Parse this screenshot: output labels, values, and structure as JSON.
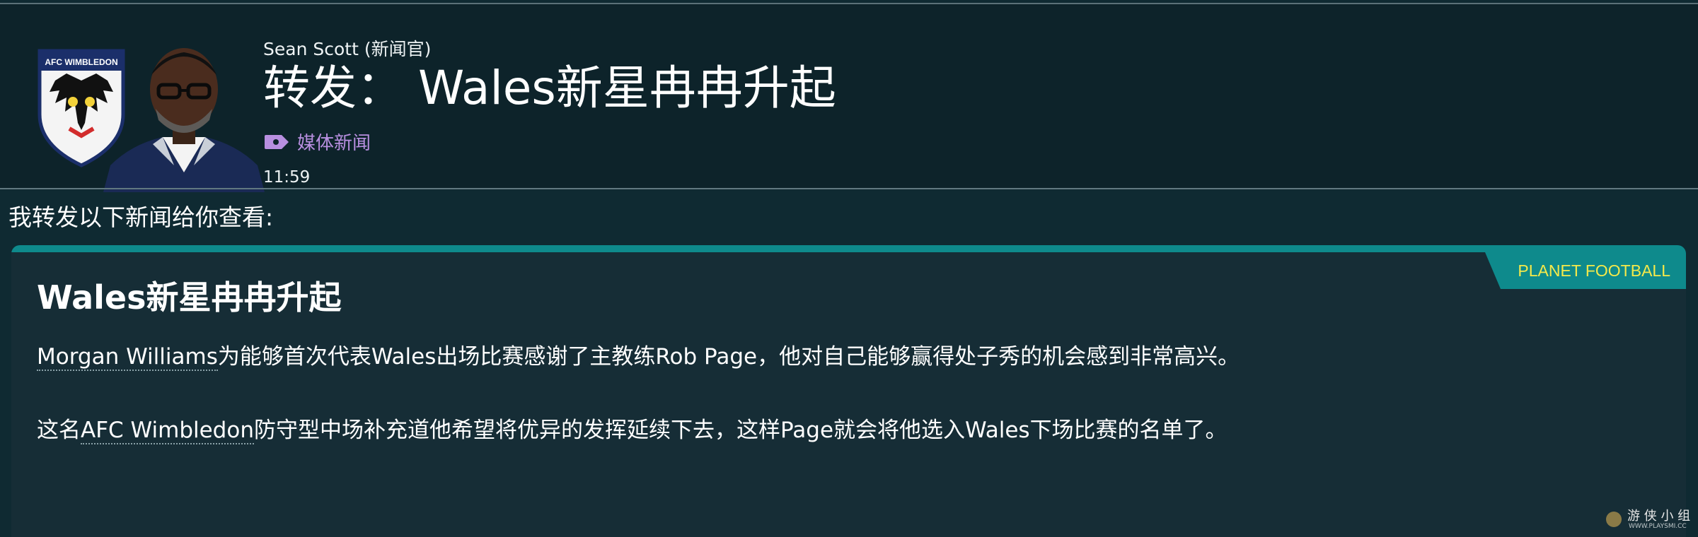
{
  "header": {
    "sender": "Sean Scott (新闻官)",
    "title": "转发： Wales新星冉冉升起",
    "tag": "媒体新闻",
    "time": "11:59",
    "crest_text": "AFC WIMBLEDON"
  },
  "intro": "我转发以下新闻给你查看:",
  "article": {
    "source": "PLANET FOOTBALL",
    "headline": "Wales新星冉冉升起",
    "p1": {
      "player": "Morgan Williams",
      "t1": "为能够首次代表",
      "team": "Wales",
      "t2": "出场比赛感谢了主教练",
      "coach": "Rob Page",
      "t3": "，他对自己能够赢得处子秀的机会感到非常高兴。"
    },
    "p2": {
      "t1": "这名",
      "club": "AFC Wimbledon",
      "t2": "防守型中场补充道他希望将优异的发挥延续下去，这样",
      "coach": "Page",
      "t3": "就会将他选入",
      "team": "Wales",
      "t4": "下场比赛的名单了。"
    }
  },
  "watermark": {
    "text": "游 侠 小 组",
    "sub": "WWW.PLAYSMI.CC"
  },
  "colors": {
    "accent": "#0e8a8c",
    "source_text": "#f5e94a",
    "tag": "#b88fe0"
  }
}
